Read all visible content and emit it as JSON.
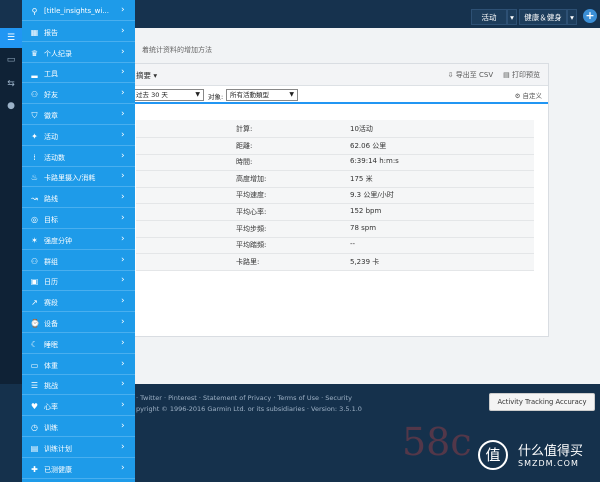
{
  "topbar": {
    "activity_button": "活动",
    "health_button": "健康＆健身",
    "plus_icon": "plus-icon"
  },
  "page": {
    "subtitle": "着统计资料的增加方法"
  },
  "report": {
    "title": "摘要",
    "export_csv": "导出至 CSV",
    "print": "打印预览",
    "period_select": "过去 30 天",
    "filter_label": "对象:",
    "type_select": "所有活動類型",
    "custom": "自定义"
  },
  "stats": [
    {
      "label": "計算:",
      "value": "10活动"
    },
    {
      "label": "距離:",
      "value": "62.06 公里"
    },
    {
      "label": "時間:",
      "value": "6:39:14 h:m:s"
    },
    {
      "label": "高度增加:",
      "value": "175 米"
    },
    {
      "label": "平均速度:",
      "value": "9.3 公里/小时"
    },
    {
      "label": "平均心率:",
      "value": "152 bpm"
    },
    {
      "label": "平均步頻:",
      "value": "78 spm"
    },
    {
      "label": "平均踏頻:",
      "value": "--"
    },
    {
      "label": "卡路里:",
      "value": "5,239 卡"
    }
  ],
  "menu": [
    {
      "label": "[title_insights_wi...",
      "icon": "location-pin-icon"
    },
    {
      "label": "报告",
      "icon": "report-icon"
    },
    {
      "label": "个人纪录",
      "icon": "trophy-icon"
    },
    {
      "label": "工具",
      "icon": "shoe-icon"
    },
    {
      "label": "好友",
      "icon": "friends-icon"
    },
    {
      "label": "徽章",
      "icon": "badge-icon"
    },
    {
      "label": "活动",
      "icon": "run-icon"
    },
    {
      "label": "活动数",
      "icon": "footsteps-icon"
    },
    {
      "label": "卡路里摄入/消耗",
      "icon": "flame-icon"
    },
    {
      "label": "路线",
      "icon": "route-icon"
    },
    {
      "label": "目标",
      "icon": "target-icon"
    },
    {
      "label": "强度分钟",
      "icon": "intensity-icon"
    },
    {
      "label": "群组",
      "icon": "groups-icon"
    },
    {
      "label": "日历",
      "icon": "calendar-icon"
    },
    {
      "label": "赛段",
      "icon": "segment-icon"
    },
    {
      "label": "设备",
      "icon": "device-icon"
    },
    {
      "label": "睡眠",
      "icon": "sleep-icon"
    },
    {
      "label": "体重",
      "icon": "scale-icon"
    },
    {
      "label": "挑战",
      "icon": "challenge-icon"
    },
    {
      "label": "心率",
      "icon": "heart-icon"
    },
    {
      "label": "训练",
      "icon": "stopwatch-icon"
    },
    {
      "label": "训练计划",
      "icon": "plan-icon"
    },
    {
      "label": "已测健康",
      "icon": "health-icon"
    }
  ],
  "footer": {
    "links": "· Twitter · Pinterest · Statement of Privacy · Terms of Use · Security",
    "copyright": "pyright © 1996-2016 Garmin Ltd. or its subsidiaries · Version: 3.5.1.0",
    "accuracy_button": "Activity Tracking Accuracy"
  },
  "watermark": {
    "number": "58c",
    "logo_char": "值",
    "cn": "什么值得买",
    "en": "SMZDM.COM"
  },
  "colors": {
    "menu_bg": "#1e9be9",
    "topbar_bg": "#16324e",
    "accent": "#2196f3"
  }
}
